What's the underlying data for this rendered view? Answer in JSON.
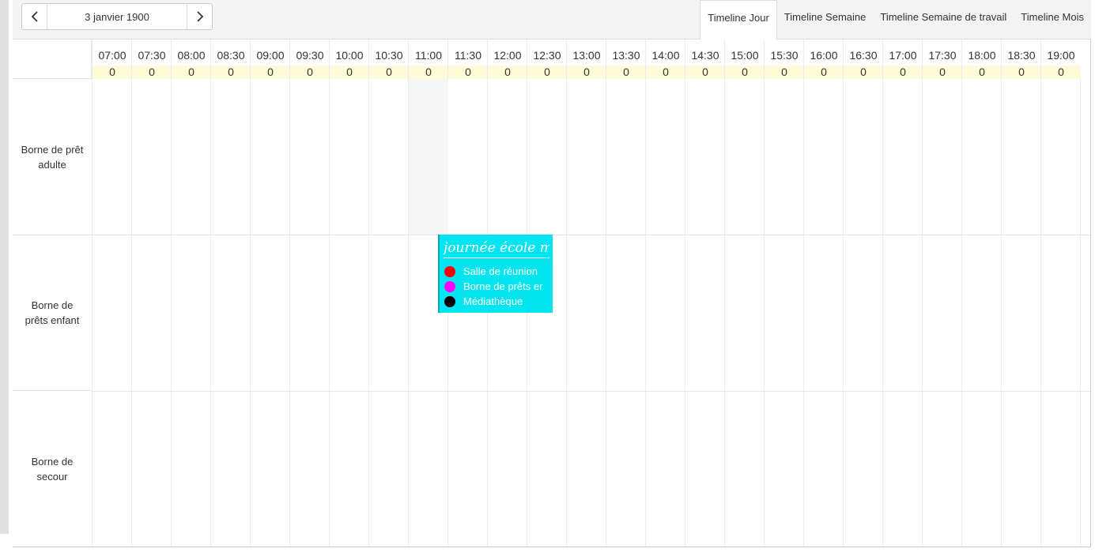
{
  "toolbar": {
    "date": "3 janvier 1900",
    "views": [
      {
        "label": "Timeline Jour",
        "active": true
      },
      {
        "label": "Timeline Semaine",
        "active": false
      },
      {
        "label": "Timeline Semaine de travail",
        "active": false
      },
      {
        "label": "Timeline Mois",
        "active": false
      }
    ]
  },
  "time_slots": [
    {
      "time": "07:00",
      "count": "0"
    },
    {
      "time": "07:30",
      "count": "0"
    },
    {
      "time": "08:00",
      "count": "0"
    },
    {
      "time": "08:30",
      "count": "0"
    },
    {
      "time": "09:00",
      "count": "0"
    },
    {
      "time": "09:30",
      "count": "0"
    },
    {
      "time": "10:00",
      "count": "0"
    },
    {
      "time": "10:30",
      "count": "0"
    },
    {
      "time": "11:00",
      "count": "0"
    },
    {
      "time": "11:30",
      "count": "0"
    },
    {
      "time": "12:00",
      "count": "0"
    },
    {
      "time": "12:30",
      "count": "0"
    },
    {
      "time": "13:00",
      "count": "0"
    },
    {
      "time": "13:30",
      "count": "0"
    },
    {
      "time": "14:00",
      "count": "0"
    },
    {
      "time": "14:30",
      "count": "0"
    },
    {
      "time": "15:00",
      "count": "0"
    },
    {
      "time": "15:30",
      "count": "0"
    },
    {
      "time": "16:00",
      "count": "0"
    },
    {
      "time": "16:30",
      "count": "0"
    },
    {
      "time": "17:00",
      "count": "0"
    },
    {
      "time": "17:30",
      "count": "0"
    },
    {
      "time": "18:00",
      "count": "0"
    },
    {
      "time": "18:30",
      "count": "0"
    },
    {
      "time": "19:00",
      "count": "0"
    }
  ],
  "resources": [
    {
      "label": "Borne de prêt adulte"
    },
    {
      "label": "Borne de prêts enfant"
    },
    {
      "label": "Borne de secour"
    }
  ],
  "event": {
    "title": "journée école mc",
    "items": [
      {
        "label": "Salle de réunion",
        "color": "#ff0000"
      },
      {
        "label": "Borne de prêts er",
        "color": "#ff00ff"
      },
      {
        "label": "Médiathèque",
        "color": "#000000"
      }
    ]
  },
  "colors": {
    "event_background": "#00e5f0",
    "count_background": "#fffbd8"
  }
}
